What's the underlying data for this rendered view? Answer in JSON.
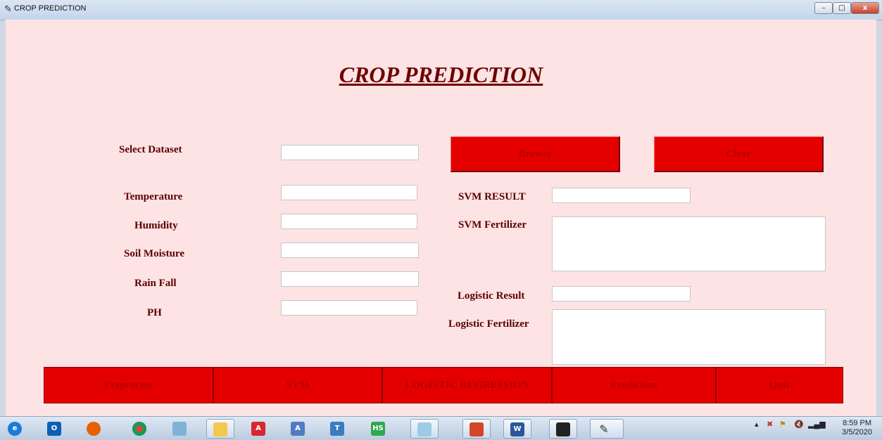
{
  "window": {
    "title": "CROP PREDICTION",
    "min_label": "–",
    "max_label": "□",
    "close_label": "x"
  },
  "form": {
    "heading": "CROP PREDICTION",
    "select_dataset_label": "Select Dataset",
    "temperature_label": "Temperature",
    "humidity_label": "Humidity",
    "soil_moisture_label": "Soil Moisture",
    "rain_fall_label": "Rain Fall",
    "ph_label": "PH",
    "svm_result_label": "SVM RESULT",
    "svm_fertilizer_label": "SVM Fertilizer",
    "logistic_result_label": "Logistic Result",
    "logistic_fertilizer_label": "Logistic Fertilizer",
    "dataset_value": "",
    "temperature_value": "",
    "humidity_value": "",
    "soil_moisture_value": "",
    "rain_fall_value": "",
    "ph_value": "",
    "svm_result_value": "",
    "svm_fertilizer_value": "",
    "logistic_result_value": "",
    "logistic_fertilizer_value": ""
  },
  "buttons": {
    "browse": "Browse",
    "clear": "Clear",
    "preprocess": "Preprocess",
    "svm": "SVM",
    "logistic_regression": "LOGISTIC REGRESSION",
    "prediction": "Prediction",
    "quit": "Quit"
  },
  "taskbar": {
    "clock_time": "8:59 PM",
    "clock_date": "3/5/2020",
    "apps": [
      "ie-icon",
      "outlook-icon",
      "firefox-icon",
      "chrome-icon",
      "notepad-icon",
      "file-explorer-icon",
      "acrobat-icon",
      "editor-icon",
      "tool-icon",
      "hs-icon",
      "paint-icon",
      "powerpoint-icon",
      "word-icon",
      "terminal-icon",
      "python-feather-icon"
    ]
  },
  "colors": {
    "client_bg": "#fde3e3",
    "button_red": "#e50000",
    "heading_color": "#6f0000"
  }
}
